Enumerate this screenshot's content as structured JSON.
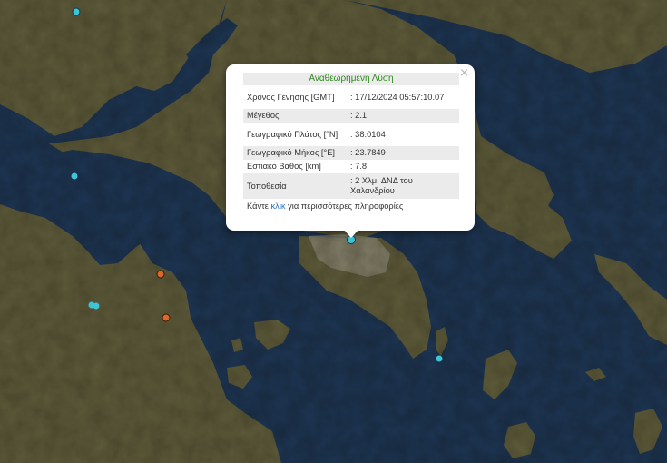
{
  "popup": {
    "title": "Αναθεωρημένη Λύση",
    "rows": [
      {
        "label": "Χρόνος Γένησης [GMT]",
        "value": ": 17/12/2024 05:57:10.07"
      },
      {
        "label": "Μέγεθος",
        "value": ": 2.1"
      },
      {
        "label": "Γεωγραφικό Πλάτος [°N]",
        "value": ": 38.0104"
      },
      {
        "label": "Γεωγραφικό Μήκος [°E]",
        "value": ": 23.7849"
      },
      {
        "label": "Εστιακό Βάθος [km]",
        "value": ": 7.8"
      },
      {
        "label": "Τοποθεσία",
        "value": ": 2 Χλμ. ΔΝΔ του Χαλανδρίου"
      }
    ],
    "more_prefix": "Κάντε ",
    "more_link": "κλικ",
    "more_suffix": " για περισσότερες πληροφορίες",
    "close_label": "×"
  },
  "colors": {
    "sea": "#1d3554",
    "land": "#5c5a3a",
    "marker_cyan": "#3fc3d6",
    "marker_orange": "#d9682a",
    "title_green": "#2f8a1f"
  }
}
